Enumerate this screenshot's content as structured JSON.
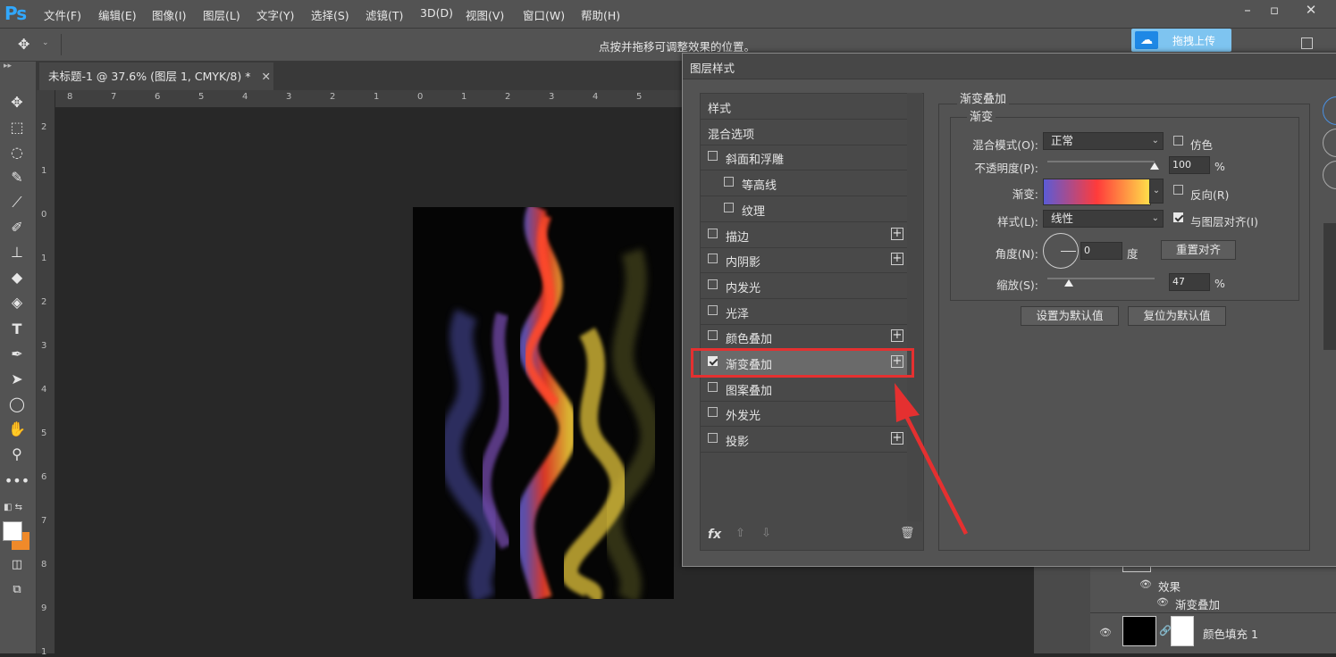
{
  "app": {
    "logo": "Ps",
    "menu": [
      "文件(F)",
      "编辑(E)",
      "图像(I)",
      "图层(L)",
      "文字(Y)",
      "选择(S)",
      "滤镜(T)",
      "3D(D)",
      "视图(V)",
      "窗口(W)",
      "帮助(H)"
    ]
  },
  "options": {
    "hint": "点按并拖移可调整效果的位置。",
    "upload_label": "拖拽上传"
  },
  "document": {
    "tab_title": "未标题-1 @ 37.6% (图层 1, CMYK/8) *",
    "hruler": [
      "8",
      "7",
      "6",
      "5",
      "4",
      "3",
      "2",
      "1",
      "0",
      "1",
      "2",
      "3",
      "4",
      "5"
    ],
    "vruler": [
      "2",
      "1",
      "0",
      "1",
      "2",
      "3",
      "4",
      "5",
      "6",
      "7",
      "8",
      "9",
      "1"
    ]
  },
  "dialog": {
    "title": "图层样式",
    "style_list": [
      {
        "label": "样式",
        "checkbox": false,
        "plus": false
      },
      {
        "label": "混合选项",
        "checkbox": false,
        "plus": false
      },
      {
        "label": "斜面和浮雕",
        "checkbox": true,
        "checked": false,
        "plus": false
      },
      {
        "label": "等高线",
        "checkbox": true,
        "checked": false,
        "plus": false
      },
      {
        "label": "纹理",
        "checkbox": true,
        "checked": false,
        "plus": false
      },
      {
        "label": "描边",
        "checkbox": true,
        "checked": false,
        "plus": true
      },
      {
        "label": "内阴影",
        "checkbox": true,
        "checked": false,
        "plus": true
      },
      {
        "label": "内发光",
        "checkbox": true,
        "checked": false,
        "plus": false
      },
      {
        "label": "光泽",
        "checkbox": true,
        "checked": false,
        "plus": false
      },
      {
        "label": "颜色叠加",
        "checkbox": true,
        "checked": false,
        "plus": true
      },
      {
        "label": "渐变叠加",
        "checkbox": true,
        "checked": true,
        "plus": true
      },
      {
        "label": "图案叠加",
        "checkbox": true,
        "checked": false,
        "plus": false
      },
      {
        "label": "外发光",
        "checkbox": true,
        "checked": false,
        "plus": false
      },
      {
        "label": "投影",
        "checkbox": true,
        "checked": false,
        "plus": true
      }
    ],
    "fx_label": "fx",
    "panel": {
      "group_title": "渐变叠加",
      "subgroup_title": "渐变",
      "blend_mode_label": "混合模式(O):",
      "blend_mode_value": "正常",
      "dither_label": "仿色",
      "opacity_label": "不透明度(P):",
      "opacity_value": "100",
      "opacity_level": 1.0,
      "percent": "%",
      "gradient_label": "渐变:",
      "reverse_label": "反向(R)",
      "style_label": "样式(L):",
      "style_value": "线性",
      "align_label": "与图层对齐(I)",
      "angle_label": "角度(N):",
      "angle_value": "0",
      "degree_label": "度",
      "reset_align_button": "重置对齐",
      "scale_label": "缩放(S):",
      "scale_value": "47",
      "scale_level": 0.2,
      "set_default_button": "设置为默认值",
      "reset_default_button": "复位为默认值"
    }
  },
  "layers": {
    "effects_label": "效果",
    "gradient_overlay_label": "渐变叠加",
    "fill_layer_name": "颜色填充 1"
  },
  "colors": {
    "highlight": "#e53030",
    "gradient": [
      "#5b5bd6",
      "#ff3b3b",
      "#ffe04a"
    ]
  }
}
